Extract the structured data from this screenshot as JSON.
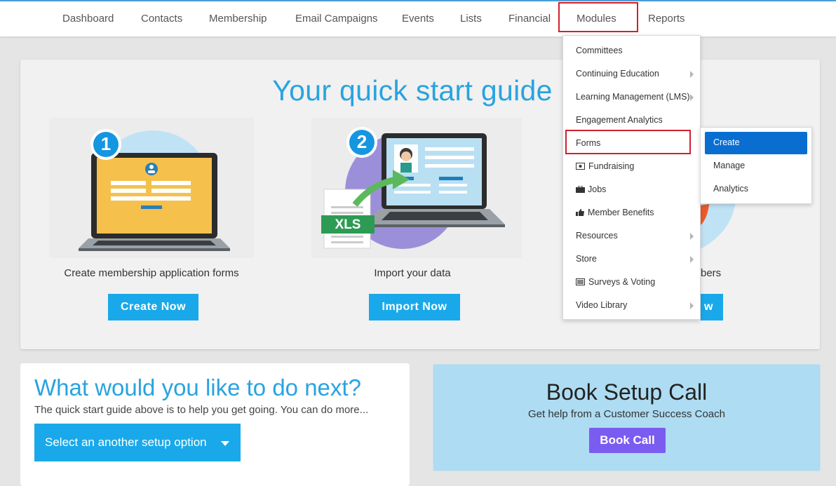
{
  "nav": {
    "items": [
      {
        "label": "Dashboard"
      },
      {
        "label": "Contacts"
      },
      {
        "label": "Membership"
      },
      {
        "label": "Email Campaigns"
      },
      {
        "label": "Events"
      },
      {
        "label": "Lists"
      },
      {
        "label": "Financial"
      },
      {
        "label": "Modules"
      },
      {
        "label": "Reports"
      }
    ]
  },
  "quick_start": {
    "title": "Your quick start guide",
    "steps": [
      {
        "number": "1",
        "caption": "Create membership application forms",
        "button": "Create Now"
      },
      {
        "number": "2",
        "caption": "Import your data",
        "button": "Import Now",
        "badge": "XLS"
      },
      {
        "caption_partial": "bers",
        "button_partial": "w"
      }
    ]
  },
  "next": {
    "title": "What would you like to do next?",
    "subtitle": "The quick start guide above is to help you get going. You can do more...",
    "select_label": "Select an another setup option"
  },
  "book": {
    "title": "Book Setup Call",
    "subtitle": "Get help from a Customer Success Coach",
    "button": "Book Call"
  },
  "modules_menu": {
    "items": [
      {
        "label": "Committees",
        "icon": "",
        "submenu": false
      },
      {
        "label": "Continuing Education",
        "icon": "",
        "submenu": true
      },
      {
        "label": "Learning Management (LMS)",
        "icon": "",
        "submenu": true
      },
      {
        "label": "Engagement Analytics",
        "icon": "",
        "submenu": false
      },
      {
        "label": "Forms",
        "icon": "",
        "submenu": false
      },
      {
        "label": "Fundraising",
        "icon": "money-icon",
        "submenu": false
      },
      {
        "label": "Jobs",
        "icon": "briefcase-icon",
        "submenu": false
      },
      {
        "label": "Member Benefits",
        "icon": "thumbs-up-icon",
        "submenu": false
      },
      {
        "label": "Resources",
        "icon": "",
        "submenu": true
      },
      {
        "label": "Store",
        "icon": "",
        "submenu": true
      },
      {
        "label": "Surveys & Voting",
        "icon": "list-icon",
        "submenu": false
      },
      {
        "label": "Video Library",
        "icon": "",
        "submenu": true
      }
    ]
  },
  "forms_submenu": {
    "items": [
      {
        "label": "Create",
        "active": true
      },
      {
        "label": "Manage",
        "active": false
      },
      {
        "label": "Analytics",
        "active": false
      }
    ]
  },
  "colors": {
    "accent_blue": "#19a9ea",
    "title_blue": "#29a3e0",
    "book_purple": "#7b5cf0",
    "highlight_red": "#d0202e",
    "submenu_active": "#0a6ed1",
    "book_bg": "#aedcf2"
  }
}
